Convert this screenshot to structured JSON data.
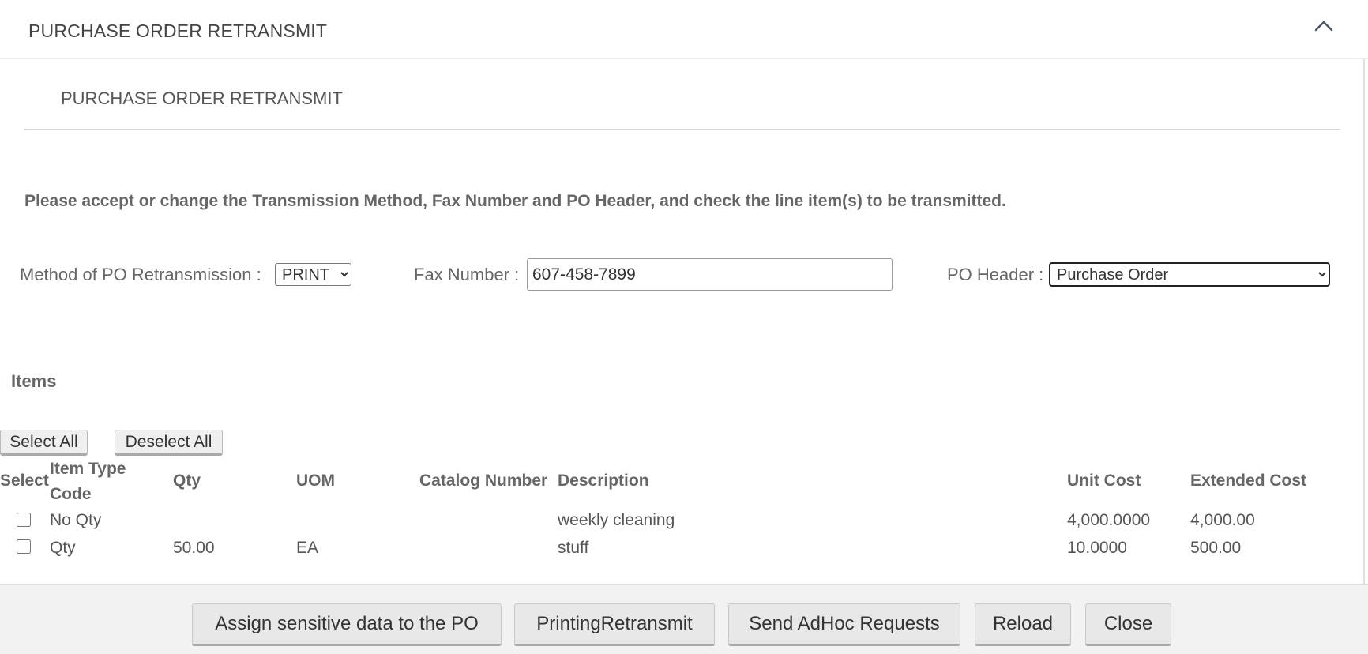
{
  "header": {
    "title": "PURCHASE ORDER RETRANSMIT",
    "collapse_icon": "chevron-up-icon"
  },
  "section": {
    "subtitle": "PURCHASE ORDER RETRANSMIT"
  },
  "instructions": "Please accept or change the Transmission Method, Fax Number and PO Header, and check the line item(s) to be transmitted.",
  "form": {
    "method_label": "Method of PO Retransmission :",
    "method_value": "PRINT",
    "fax_label": "Fax Number :",
    "fax_value": "607-458-7899",
    "po_header_label": "PO Header :",
    "po_header_value": "Purchase Order"
  },
  "items": {
    "label": "Items",
    "select_all": "Select All",
    "deselect_all": "Deselect All",
    "columns": {
      "select": "Select",
      "item_type_code_line1": "Item Type",
      "item_type_code_line2": "Code",
      "qty": "Qty",
      "uom": "UOM",
      "catalog_number": "Catalog Number",
      "description": "Description",
      "unit_cost": "Unit Cost",
      "extended_cost": "Extended Cost"
    },
    "rows": [
      {
        "checked": false,
        "item_type_code": "No Qty",
        "qty": "",
        "uom": "",
        "catalog_number": "",
        "description": "weekly cleaning",
        "unit_cost": "4,000.0000",
        "extended_cost": "4,000.00"
      },
      {
        "checked": false,
        "item_type_code": "Qty",
        "qty": "50.00",
        "uom": "EA",
        "catalog_number": "",
        "description": "stuff",
        "unit_cost": "10.0000",
        "extended_cost": "500.00"
      }
    ]
  },
  "footer": {
    "assign_sensitive": "Assign sensitive data to the PO",
    "printing_retransmit": "PrintingRetransmit",
    "send_adhoc": "Send AdHoc Requests",
    "reload": "Reload",
    "close": "Close"
  }
}
